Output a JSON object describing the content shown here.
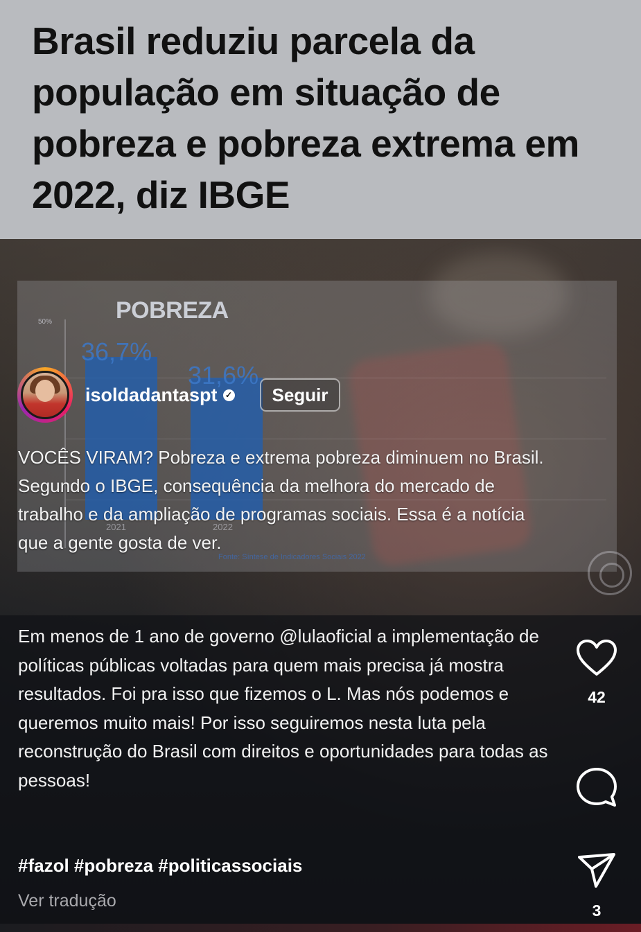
{
  "headline": {
    "title": "Brasil reduziu parcela da população em situação de pobreza e pobreza extrema em 2022, diz IBGE"
  },
  "video": {
    "chart": {
      "title": "POBREZA",
      "axis_top_label": "50%",
      "bars": [
        {
          "year": "2021",
          "value_label": "36,7%"
        },
        {
          "year": "2022",
          "value_label": "31,6%"
        }
      ],
      "source": "Fonte: Síntese de Indicadores Sociais 2022"
    },
    "author": {
      "username": "isoldadantaspt",
      "follow_label": "Seguir"
    },
    "caption": "VOCÊS VIRAM? Pobreza e extrema pobreza diminuem no Brasil. Segundo o IBGE, consequência da melhora do mercado de trabalho e da ampliação de programas sociais. Essa é a notícia que a gente gosta de ver."
  },
  "post": {
    "text": "Em menos de 1 ano de governo @lulaoficial a implementação de políticas públicas voltadas para quem mais precisa já mostra resultados. Foi pra isso que fizemos o L. Mas nós podemos e queremos muito mais! Por isso seguiremos nesta luta pela reconstrução do Brasil com direitos e oportunidades para todas as pessoas!",
    "hashtags": "#fazol #pobreza #politicassociais",
    "translate_label": "Ver tradução"
  },
  "actions": {
    "likes": "42",
    "shares": "3",
    "icons": [
      "heart-icon",
      "comment-icon",
      "send-icon"
    ]
  }
}
